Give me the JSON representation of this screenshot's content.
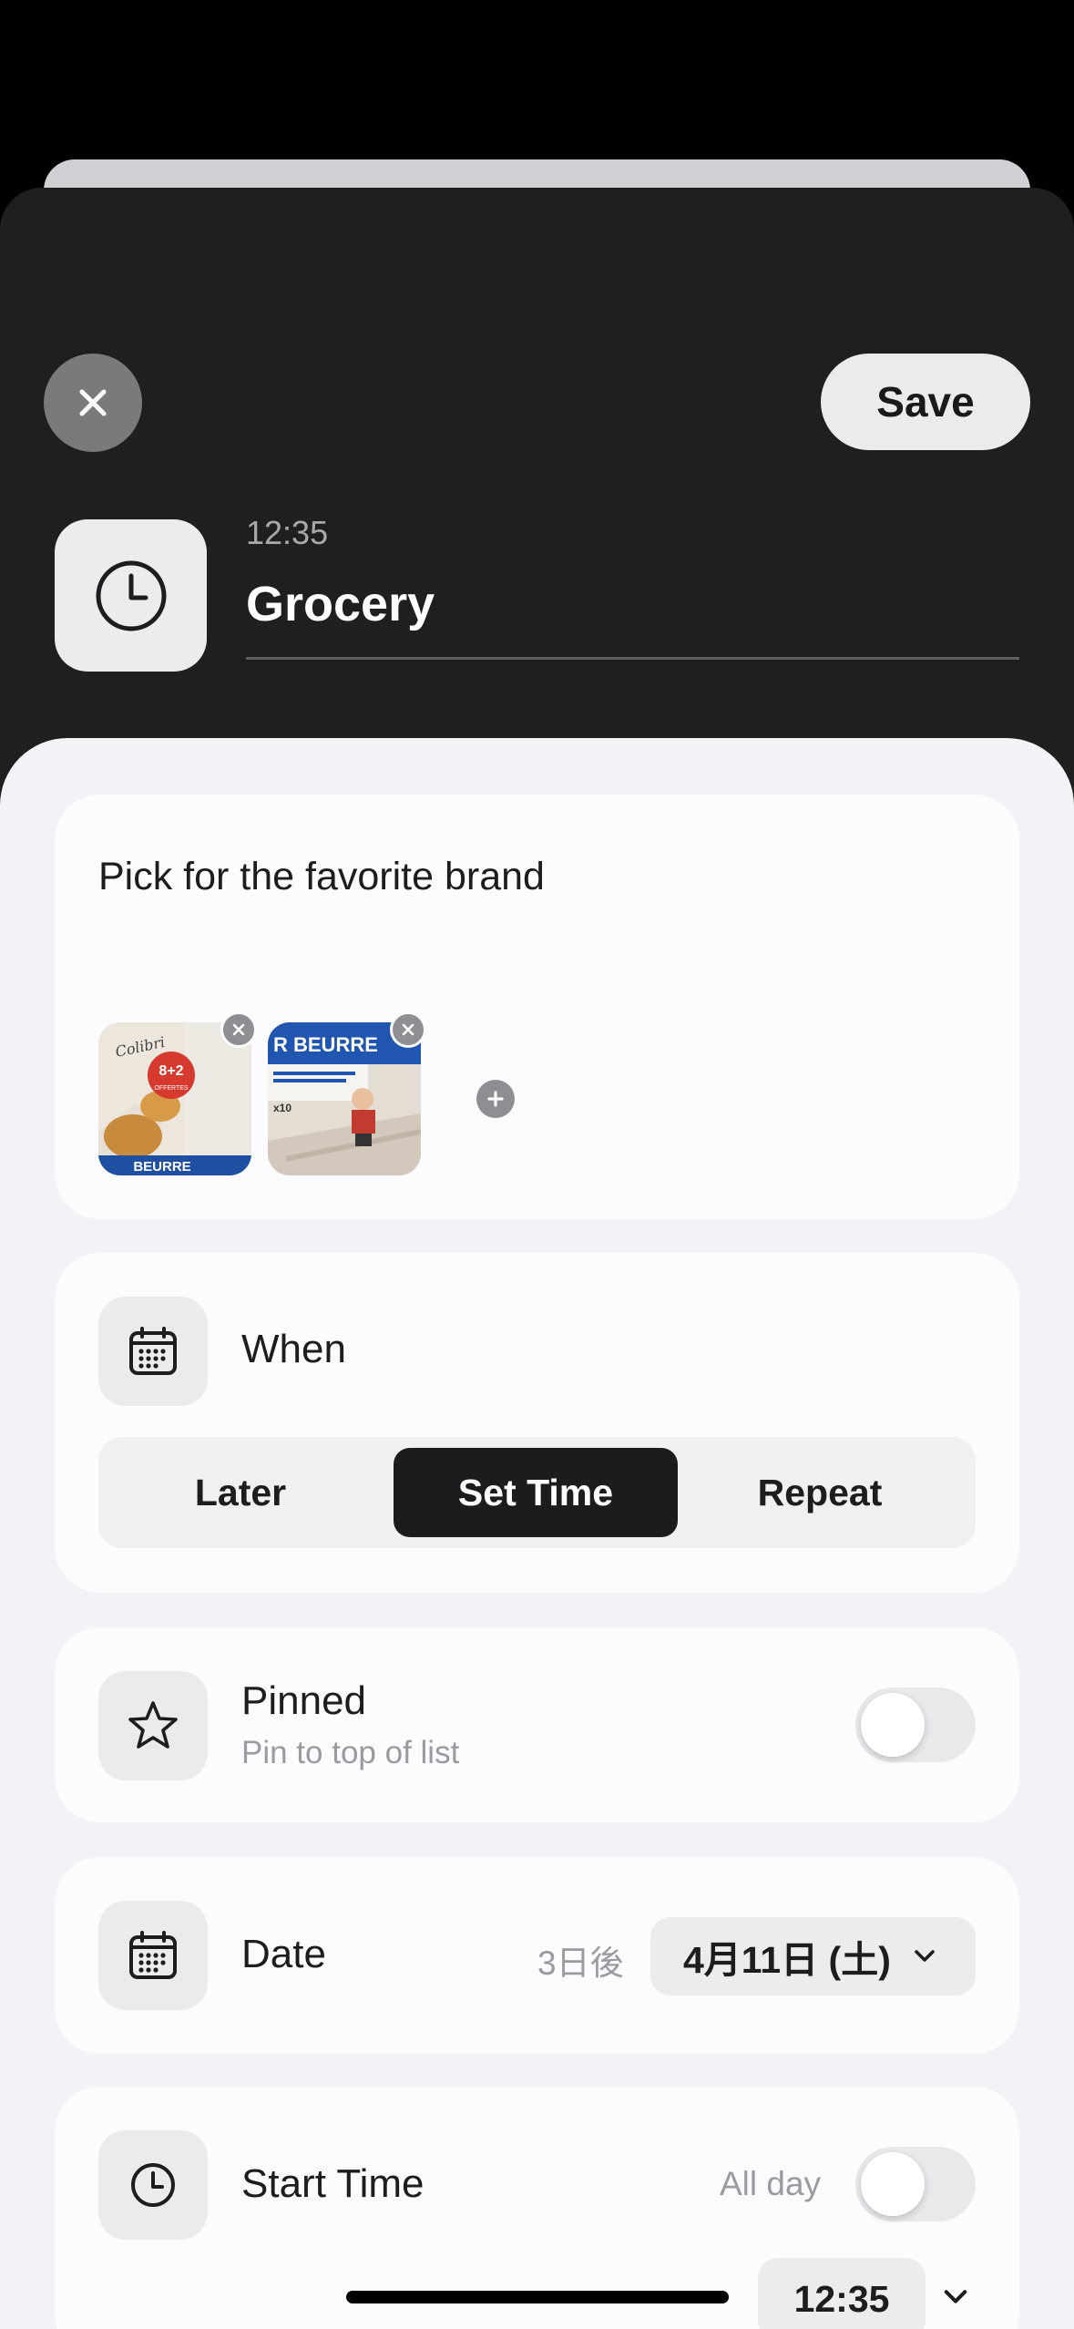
{
  "header": {
    "save_label": "Save",
    "time": "12:35",
    "title": "Grocery"
  },
  "note": {
    "text": "Pick for the favorite brand",
    "photos": [
      {
        "alt": "Madeleine package photo",
        "overlay_text": "8+2",
        "overlay_sub": "OFFERTES",
        "brand": "Colibri",
        "bottom_text": "BEURRE"
      },
      {
        "alt": "Butter package photo",
        "top_text": "R BEURRE",
        "small_text": "x10"
      }
    ]
  },
  "when": {
    "label": "When",
    "options": [
      "Later",
      "Set Time",
      "Repeat"
    ],
    "selected": "Set Time"
  },
  "pinned": {
    "label": "Pinned",
    "subtitle": "Pin to top of list",
    "on": false
  },
  "date": {
    "label": "Date",
    "relative": "3日後",
    "value": "4月11日 (土)"
  },
  "start_time": {
    "label": "Start Time",
    "all_day_label": "All day",
    "all_day_on": false,
    "time": "12:35"
  },
  "colors": {
    "dark_sheet": "#1f1f1f",
    "light_sheet": "#f2f2f7",
    "card": "#fcfcfe",
    "selected_segment": "#1c1c1e"
  }
}
